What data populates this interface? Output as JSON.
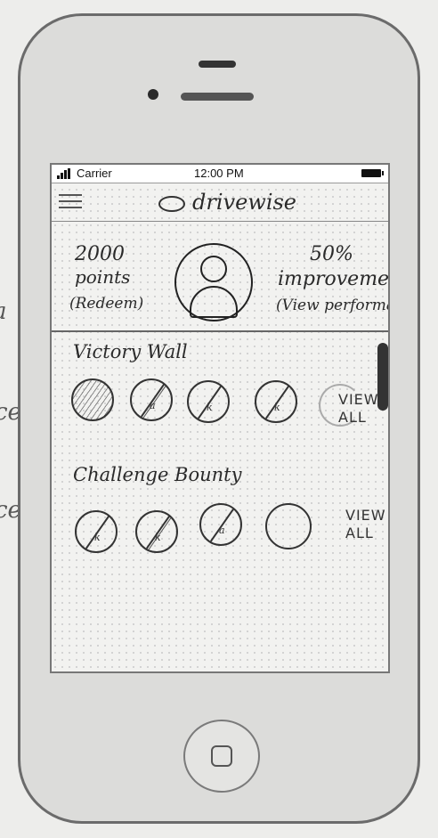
{
  "status_bar": {
    "carrier": "Carrier",
    "time": "12:00 PM"
  },
  "header": {
    "app_name": "drivewise"
  },
  "profile": {
    "points": "2000",
    "points_label": "points",
    "redeem": "(Redeem)",
    "improvement_value": "50%",
    "improvement_label": "improvement",
    "view_performance": "(View performance"
  },
  "victory_wall": {
    "title": "Victory Wall",
    "view_all": "VIEW ALL"
  },
  "challenge_bounty": {
    "title": "Challenge Bounty",
    "view_all": "VIEW ALL"
  },
  "icons": [
    "menu-icon",
    "logo-icon",
    "avatar-icon",
    "signal-icon",
    "battery-icon",
    "home-button-icon"
  ]
}
